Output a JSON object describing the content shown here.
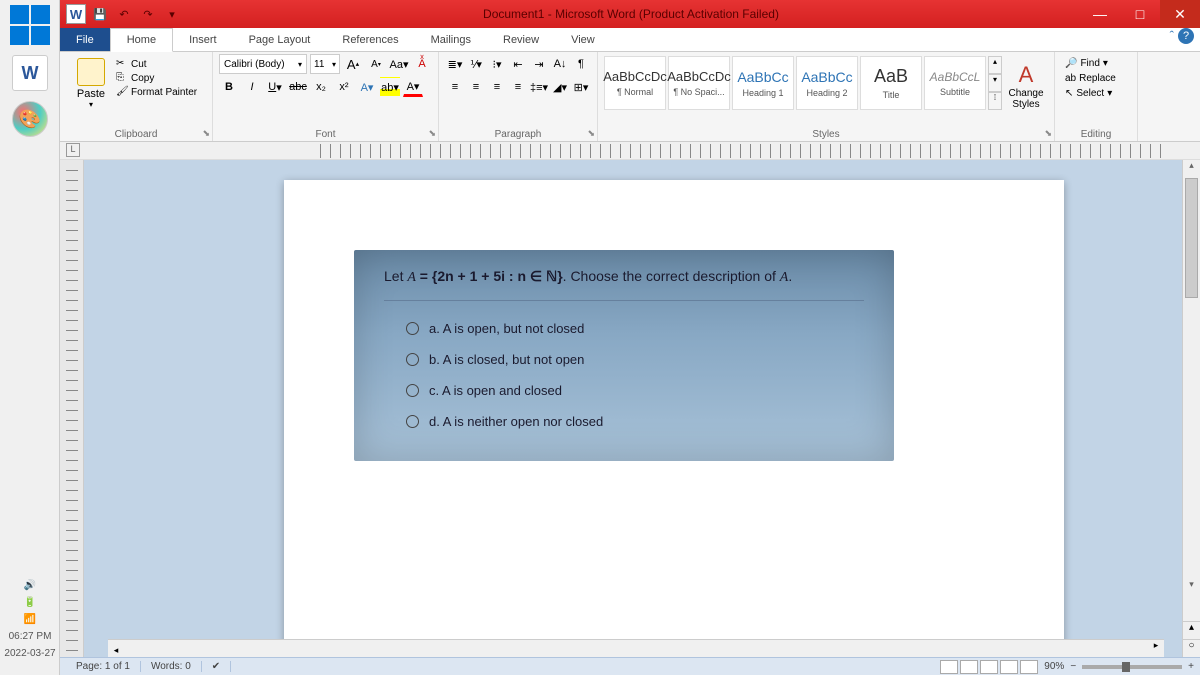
{
  "titlebar": {
    "title": "Document1 - Microsoft Word (Product Activation Failed)"
  },
  "tabs": {
    "file": "File",
    "home": "Home",
    "insert": "Insert",
    "page_layout": "Page Layout",
    "references": "References",
    "mailings": "Mailings",
    "review": "Review",
    "view": "View"
  },
  "clipboard": {
    "paste": "Paste",
    "cut": "Cut",
    "copy": "Copy",
    "format_painter": "Format Painter",
    "label": "Clipboard"
  },
  "font": {
    "name": "Calibri (Body)",
    "size": "11",
    "label": "Font"
  },
  "paragraph": {
    "label": "Paragraph"
  },
  "styles": {
    "items": [
      {
        "preview": "AaBbCcDc",
        "label": "¶ Normal"
      },
      {
        "preview": "AaBbCcDc",
        "label": "¶ No Spaci..."
      },
      {
        "preview": "AaBbCc",
        "label": "Heading 1"
      },
      {
        "preview": "AaBbCc",
        "label": "Heading 2"
      },
      {
        "preview": "AaB",
        "label": "Title"
      },
      {
        "preview": "AaBbCcL",
        "label": "Subtitle"
      }
    ],
    "change": "Change Styles",
    "label": "Styles"
  },
  "editing": {
    "find": "Find",
    "replace": "Replace",
    "select": "Select",
    "label": "Editing"
  },
  "document": {
    "question_prefix": "Let ",
    "question_var": "A",
    "question_eq": " = {2n + 1 + 5i : n ∈ ℕ}",
    "question_suffix": ". Choose the correct description of ",
    "question_end": ".",
    "options": {
      "a": "a.  A is open, but not closed",
      "b": "b.  A is closed, but not open",
      "c": "c.  A is open and closed",
      "d": "d.  A is neither open nor closed"
    }
  },
  "statusbar": {
    "page": "Page: 1 of 1",
    "words": "Words: 0",
    "zoom": "90%"
  },
  "taskbar": {
    "time": "06:27 PM",
    "date": "2022-03-27"
  }
}
